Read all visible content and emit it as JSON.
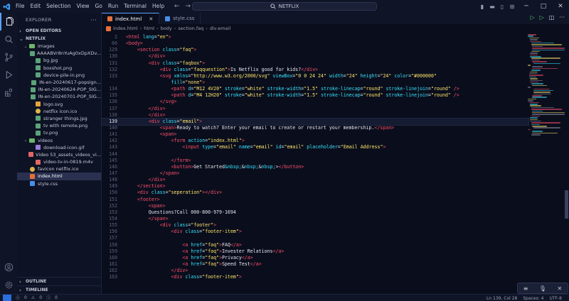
{
  "titlebar": {
    "menu": [
      "File",
      "Edit",
      "Selection",
      "View",
      "Go",
      "Run",
      "Terminal",
      "Help"
    ],
    "search_title": "NETFLIX"
  },
  "sidebar": {
    "open_editors": "OPEN EDITORS",
    "project": "NETFLIX",
    "items": [
      {
        "label": "images",
        "type": "folder",
        "depth": 1,
        "open": true
      },
      {
        "label": "AAAABVr8nYuAg0xDpXDv...",
        "type": "img",
        "depth": 2
      },
      {
        "label": "bg.jpg",
        "type": "img",
        "depth": 2
      },
      {
        "label": "boxshot.png",
        "type": "img",
        "depth": 2
      },
      {
        "label": "device-pile-in.png",
        "type": "img",
        "depth": 2
      },
      {
        "label": "IN-en-20240617-popsign...",
        "type": "img",
        "depth": 2
      },
      {
        "label": "IN-en-20240624-POP_SIG...",
        "type": "img",
        "depth": 2
      },
      {
        "label": "IN-en-20240701-POP_SIG...",
        "type": "img",
        "depth": 2
      },
      {
        "label": "logo.svg",
        "type": "svg",
        "depth": 2
      },
      {
        "label": "netflix icon.ico",
        "type": "ico",
        "depth": 2
      },
      {
        "label": "stranger things.jpg",
        "type": "img",
        "depth": 2
      },
      {
        "label": "tv with remote.png",
        "type": "img",
        "depth": 2
      },
      {
        "label": "tv.png",
        "type": "img",
        "depth": 2
      },
      {
        "label": "videos",
        "type": "folder",
        "depth": 1,
        "open": true
      },
      {
        "label": "download-icon.gif",
        "type": "gif",
        "depth": 2
      },
      {
        "label": "Video 53_assets_videos_vi...",
        "type": "mp4",
        "depth": 2
      },
      {
        "label": "video-tv-in-0819.m4v",
        "type": "mp4",
        "depth": 2
      },
      {
        "label": "favicon netflix.ico",
        "type": "ico",
        "depth": 1
      },
      {
        "label": "index.html",
        "type": "html",
        "depth": 1,
        "selected": true
      },
      {
        "label": "style.css",
        "type": "css",
        "depth": 1
      }
    ],
    "outline": "OUTLINE",
    "timeline": "TIMELINE"
  },
  "tabs": [
    {
      "label": "index.html",
      "active": true
    },
    {
      "label": "style.css",
      "active": false
    }
  ],
  "breadcrumb": [
    "index.html",
    "html",
    "body",
    "section.faq",
    "div.email"
  ],
  "code_lines": [
    {
      "n": "2",
      "html": "<span class=\"t-tag\">&lt;html</span> <span class=\"t-attr\">lang</span>=<span class=\"t-str\">\"en\"</span><span class=\"t-tag\">&gt;</span>"
    },
    {
      "n": "60",
      "html": "<span class=\"t-tag\">&lt;body&gt;</span>"
    },
    {
      "n": "129",
      "html": "    <span class=\"t-tag\">&lt;section</span> <span class=\"t-attr\">class</span>=<span class=\"t-str\">\"faq\"</span><span class=\"t-tag\">&gt;</span>"
    },
    {
      "n": "130",
      "html": "        <span class=\"t-tag\">&lt;/div&gt;</span>"
    },
    {
      "n": "131",
      "html": "        <span class=\"t-tag\">&lt;div</span> <span class=\"t-attr\">class</span>=<span class=\"t-str\">\"faqbox\"</span><span class=\"t-tag\">&gt;</span>"
    },
    {
      "n": "132",
      "html": "            <span class=\"t-tag\">&lt;div</span> <span class=\"t-attr\">class</span>=<span class=\"t-str\">\"faqquestion\"</span><span class=\"t-tag\">&gt;</span>Is Netflix good for kids?<span class=\"t-tag\">&lt;/div&gt;</span>"
    },
    {
      "n": "133",
      "html": "            <span class=\"t-tag\">&lt;svg</span> <span class=\"t-attr\">xmlns</span>=<span class=\"t-str\">\"http://www.w3.org/2000/svg\"</span> <span class=\"t-attr\">viewBox</span>=<span class=\"t-str\">\"0 0 24 24\"</span> <span class=\"t-attr\">width</span>=<span class=\"t-str\">\"24\"</span> <span class=\"t-attr\">height</span>=<span class=\"t-str\">\"24\"</span> <span class=\"t-attr\">color</span>=<span class=\"t-str\">\"#000000\"</span>"
    },
    {
      "n": "",
      "html": "                <span class=\"t-attr\">fill</span>=<span class=\"t-str\">\"none\"</span><span class=\"t-tag\">&gt;</span>"
    },
    {
      "n": "134",
      "html": "                <span class=\"t-tag\">&lt;path</span> <span class=\"t-attr\">d</span>=<span class=\"t-str\">\"M12 4V20\"</span> <span class=\"t-attr\">stroke</span>=<span class=\"t-str\">\"white\"</span> <span class=\"t-attr\">stroke-width</span>=<span class=\"t-str\">\"1.5\"</span> <span class=\"t-attr\">stroke-linecap</span>=<span class=\"t-str\">\"round\"</span> <span class=\"t-attr\">stroke-linejoin</span>=<span class=\"t-str\">\"round\"</span> <span class=\"t-tag\">/&gt;</span>"
    },
    {
      "n": "135",
      "html": "                <span class=\"t-tag\">&lt;path</span> <span class=\"t-attr\">d</span>=<span class=\"t-str\">\"M4 12H20\"</span> <span class=\"t-attr\">stroke</span>=<span class=\"t-str\">\"white\"</span> <span class=\"t-attr\">stroke-width</span>=<span class=\"t-str\">\"1.5\"</span> <span class=\"t-attr\">stroke-linecap</span>=<span class=\"t-str\">\"round\"</span> <span class=\"t-attr\">stroke-linejoin</span>=<span class=\"t-str\">\"round\"</span> <span class=\"t-tag\">/&gt;</span>"
    },
    {
      "n": "136",
      "html": "            <span class=\"t-tag\">&lt;/svg&gt;</span>"
    },
    {
      "n": "137",
      "html": "        <span class=\"t-tag\">&lt;/div&gt;</span>"
    },
    {
      "n": "138",
      "html": "        <span class=\"t-tag\">&lt;/div&gt;</span>"
    },
    {
      "n": "139",
      "html": "        <span class=\"t-tag\">&lt;div</span> <span class=\"t-attr\">class</span>=<span class=\"t-str\">\"email\"</span><span class=\"t-tag\">&gt;</span>",
      "current": true
    },
    {
      "n": "140",
      "html": "            <span class=\"t-tag\">&lt;span&gt;</span>Ready to watch? Enter your email to create or restart your membership.<span class=\"t-tag\">&lt;/span&gt;</span>"
    },
    {
      "n": "141",
      "html": "            <span class=\"t-tag\">&lt;span&gt;</span>"
    },
    {
      "n": "142",
      "html": "                <span class=\"t-tag\">&lt;form</span> <span class=\"t-attr\">action</span>=<span class=\"t-str\">\"index.html\"</span><span class=\"t-tag\">&gt;</span>"
    },
    {
      "n": "143",
      "html": "                    <span class=\"t-tag\">&lt;input</span> <span class=\"t-attr\">type</span>=<span class=\"t-str\">\"email\"</span> <span class=\"t-attr\">name</span>=<span class=\"t-str\">\"email\"</span> <span class=\"t-attr\">id</span>=<span class=\"t-str\">\"email\"</span> <span class=\"t-attr\">placeholder</span>=<span class=\"t-str\">\"Email Address\"</span><span class=\"t-tag\">&gt;</span>"
    },
    {
      "n": "144",
      "html": ""
    },
    {
      "n": "145",
      "html": "                <span class=\"t-tag\">&lt;/form&gt;</span>"
    },
    {
      "n": "146",
      "html": "                <span class=\"t-tag\">&lt;button&gt;</span>Get Started<span class=\"t-ent\">&amp;nbsp;</span>&amp;<span class=\"t-ent\">nbsp;</span>&amp;<span class=\"t-ent\">nbsp;</span>&gt;<span class=\"t-tag\">&lt;/button&gt;</span>"
    },
    {
      "n": "147",
      "html": "            <span class=\"t-tag\">&lt;/span&gt;</span>"
    },
    {
      "n": "148",
      "html": "        <span class=\"t-tag\">&lt;/div&gt;</span>"
    },
    {
      "n": "149",
      "html": "    <span class=\"t-tag\">&lt;/section&gt;</span>"
    },
    {
      "n": "150",
      "html": "    <span class=\"t-tag\">&lt;div</span> <span class=\"t-attr\">class</span>=<span class=\"t-str\">\"seperation\"</span><span class=\"t-tag\">&gt;&lt;/div&gt;</span>"
    },
    {
      "n": "151",
      "html": "    <span class=\"t-tag\">&lt;footer&gt;</span>"
    },
    {
      "n": "152",
      "html": "        <span class=\"t-tag\">&lt;span&gt;</span>"
    },
    {
      "n": "153",
      "html": "        Questions?Call 000-800-979-1694"
    },
    {
      "n": "154",
      "html": "        <span class=\"t-tag\">&lt;/span&gt;</span>"
    },
    {
      "n": "155",
      "html": "            <span class=\"t-tag\">&lt;div</span> <span class=\"t-attr\">class</span>=<span class=\"t-str\">\"footer\"</span><span class=\"t-tag\">&gt;</span>"
    },
    {
      "n": "156",
      "html": "                <span class=\"t-tag\">&lt;div</span> <span class=\"t-attr\">class</span>=<span class=\"t-str\">\"footer-item\"</span><span class=\"t-tag\">&gt;</span>"
    },
    {
      "n": "157",
      "html": ""
    },
    {
      "n": "158",
      "html": "                    <span class=\"t-tag\">&lt;a</span> <span class=\"t-attr\">href</span>=<span class=\"t-str\">\"faq\"</span><span class=\"t-tag\">&gt;</span>FAQ<span class=\"t-tag\">&lt;/a&gt;</span>"
    },
    {
      "n": "159",
      "html": "                    <span class=\"t-tag\">&lt;a</span> <span class=\"t-attr\">href</span>=<span class=\"t-str\">\"faq\"</span><span class=\"t-tag\">&gt;</span>Invester Relations<span class=\"t-tag\">&lt;/a&gt;</span>"
    },
    {
      "n": "160",
      "html": "                    <span class=\"t-tag\">&lt;a</span> <span class=\"t-attr\">href</span>=<span class=\"t-str\">\"faq\"</span><span class=\"t-tag\">&gt;</span>Privacy<span class=\"t-tag\">&lt;/a&gt;</span>"
    },
    {
      "n": "161",
      "html": "                    <span class=\"t-tag\">&lt;a</span> <span class=\"t-attr\">href</span>=<span class=\"t-str\">\"faq\"</span><span class=\"t-tag\">&gt;</span>Speed Test<span class=\"t-tag\">&lt;/a&gt;</span>"
    },
    {
      "n": "162",
      "html": "                <span class=\"t-tag\">&lt;/div&gt;</span>"
    },
    {
      "n": "163",
      "html": "                <span class=\"t-tag\">&lt;div</span> <span class=\"t-attr\">class</span>=<span class=\"t-str\">\"footer-item\"</span><span class=\"t-tag\">&gt;</span>"
    }
  ],
  "status": {
    "errors": "0",
    "warnings": "0",
    "info": "0",
    "position": "Ln 139, Col 28",
    "spaces": "Spaces: 4",
    "encoding": "UTF-8"
  }
}
